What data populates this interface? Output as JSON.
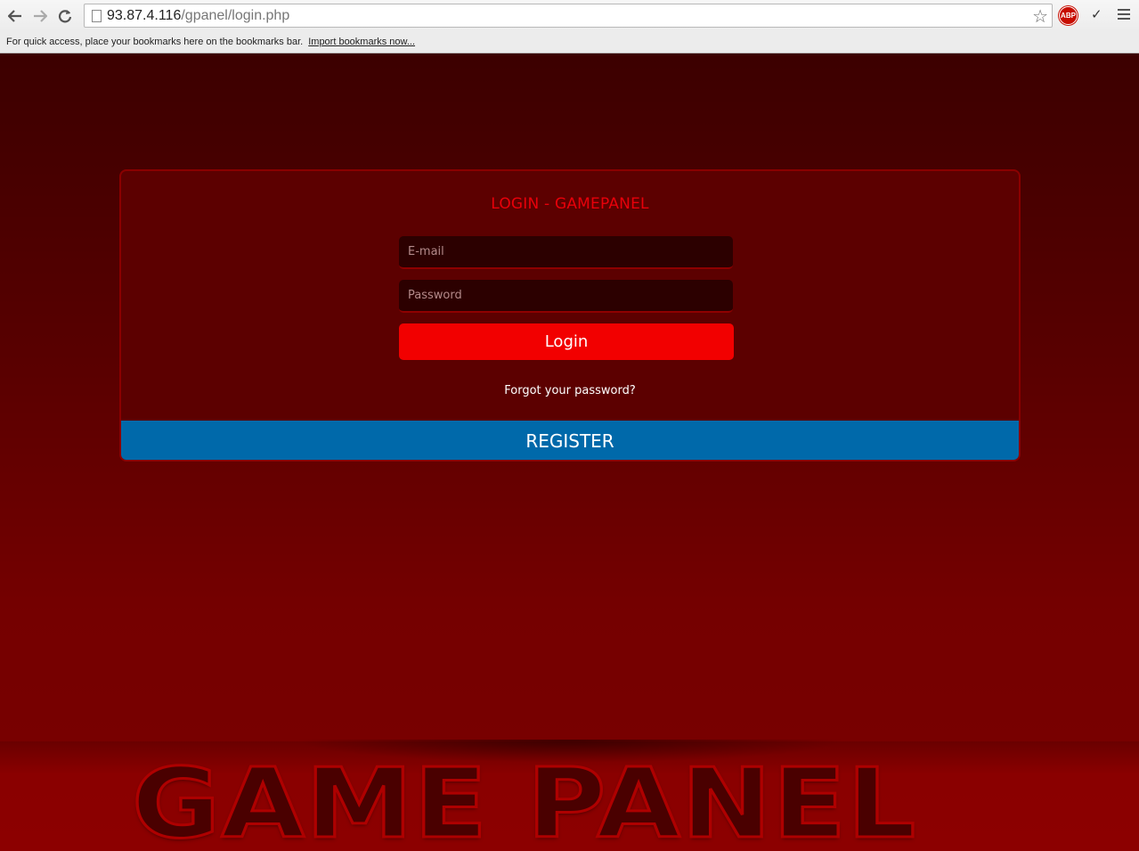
{
  "browser": {
    "url_host": "93.87.4.116",
    "url_path": "/gpanel/login.php",
    "abp_label": "ABP",
    "bookmarks_text": "For quick access, place your bookmarks here on the bookmarks bar.",
    "import_link": "Import bookmarks now..."
  },
  "login": {
    "title": "LOGIN - GAMEPANEL",
    "email_placeholder": "E-mail",
    "password_placeholder": "Password",
    "login_button": "Login",
    "forgot_link": "Forgot your password?",
    "register_button": "REGISTER"
  },
  "footer": {
    "logo_text": "GAME PANEL"
  },
  "colors": {
    "accent": "#f20000",
    "register": "#0069aa",
    "title": "#e8000a"
  }
}
